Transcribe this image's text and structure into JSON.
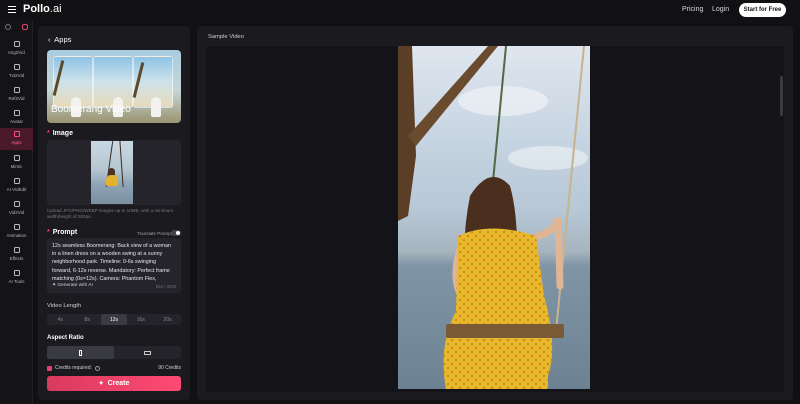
{
  "header": {
    "logo_text": "Pollo",
    "logo_suffix": ".ai",
    "nav": {
      "pricing": "Pricing",
      "login": "Login"
    },
    "cta": "Start for Free"
  },
  "rail": {
    "items": [
      {
        "label": "Img2Vid",
        "icon": "image-to-video-icon"
      },
      {
        "label": "Txt2Vid",
        "icon": "text-to-video-icon"
      },
      {
        "label": "Ref2Vid",
        "icon": "reference-to-video-icon"
      },
      {
        "label": "Avatar",
        "icon": "avatar-icon"
      },
      {
        "label": "Apps",
        "icon": "apps-icon",
        "active": true
      },
      {
        "label": "Mimic",
        "icon": "mimic-icon"
      },
      {
        "label": "AI VidEdit",
        "icon": "video-edit-icon"
      },
      {
        "label": "Vid2Vid",
        "icon": "video-to-video-icon"
      },
      {
        "label": "Animation",
        "icon": "animation-icon"
      },
      {
        "label": "Effects",
        "icon": "effects-icon"
      },
      {
        "label": "AI Tools",
        "icon": "tools-icon"
      }
    ]
  },
  "panel": {
    "back_label": "Apps",
    "banner_title": "Boomerang Video",
    "image_section": "Image",
    "upload_hint": "Upload JPG/PNG/WEBP images up to 10MB, with a minimum width/height of 300px.",
    "prompt_section": "Prompt",
    "translate_label": "Translate Prompt",
    "prompt_text": "12s seamless Boomerang: Back view of a woman in a linen dress on a wooden swing at a sunny neighborhood park. Timeline: 0-6s swinging forward, 6-12s reverse. Mandatory: Perfect frame matching (0s=12s). Camera: Phantom Flex,",
    "generate_label": "Generate with AI",
    "char_count": "553 / 4000",
    "video_length_label": "Video Length",
    "lengths": [
      "4s",
      "8s",
      "12s",
      "16s",
      "20s"
    ],
    "selected_length": "12s",
    "aspect_ratio_label": "Aspect Ratio",
    "credits_label": "Credits required:",
    "credits_value": "90 Credits",
    "create_label": "Create"
  },
  "preview": {
    "label": "Sample Video"
  },
  "colors": {
    "accent": "#ff4a74",
    "background": "#111114",
    "panel": "#1b1b1f"
  }
}
